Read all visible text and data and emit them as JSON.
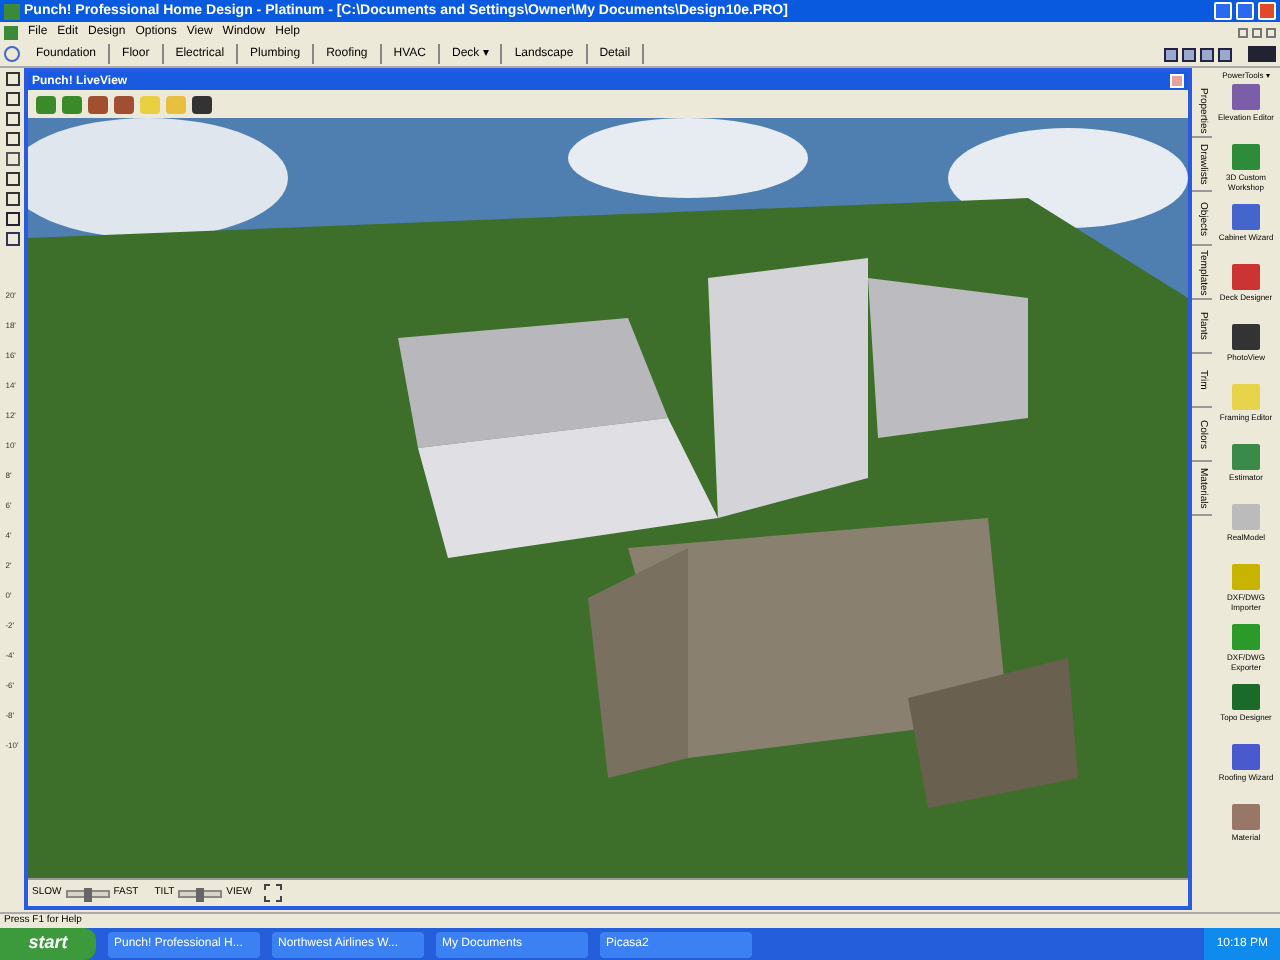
{
  "window": {
    "title": "Punch! Professional Home Design - Platinum - [C:\\Documents and Settings\\Owner\\My Documents\\Design10e.PRO]"
  },
  "menu": [
    "File",
    "Edit",
    "Design",
    "Options",
    "View",
    "Window",
    "Help"
  ],
  "tabs": [
    {
      "label": "Foundation",
      "selected": false
    },
    {
      "label": "Floor",
      "selected": false
    },
    {
      "label": "Electrical",
      "selected": false
    },
    {
      "label": "Plumbing",
      "selected": false
    },
    {
      "label": "Roofing",
      "selected": false
    },
    {
      "label": "HVAC",
      "selected": false
    },
    {
      "label": "Deck ▾",
      "selected": false
    },
    {
      "label": "Landscape",
      "selected": false
    },
    {
      "label": "Detail",
      "selected": false
    }
  ],
  "ruler": [
    "20'",
    "18'",
    "16'",
    "14'",
    "12'",
    "10'",
    "8'",
    "6'",
    "4'",
    "2'",
    "0'",
    "-2'",
    "-4'",
    "-6'",
    "-8'",
    "-10'"
  ],
  "liveview": {
    "title": "Punch! LiveView",
    "controls": [
      {
        "left": "SLOW",
        "right": "FAST",
        "level": 0.5
      },
      {
        "left": "TILT",
        "right": "VIEW",
        "level": 0.5
      }
    ]
  },
  "side_tabs": [
    "Properties",
    "Drawlists",
    "Objects",
    "Templates",
    "Plants",
    "Trim",
    "Colors",
    "Materials"
  ],
  "powertools": {
    "title": "PowerTools ▾",
    "items": [
      "Elevation Editor",
      "3D Custom Workshop",
      "Cabinet Wizard",
      "Deck Designer",
      "PhotoView",
      "Framing Editor",
      "Estimator",
      "RealModel",
      "DXF/DWG Importer",
      "DXF/DWG Exporter",
      "Topo Designer",
      "Roofing Wizard",
      "Material"
    ]
  },
  "status_bar": "Press F1 for Help",
  "taskbar": {
    "start": "start",
    "items": [
      "Punch! Professional H...",
      "Northwest Airlines W...",
      "My Documents",
      "Picasa2"
    ],
    "clock": "10:18 PM"
  }
}
